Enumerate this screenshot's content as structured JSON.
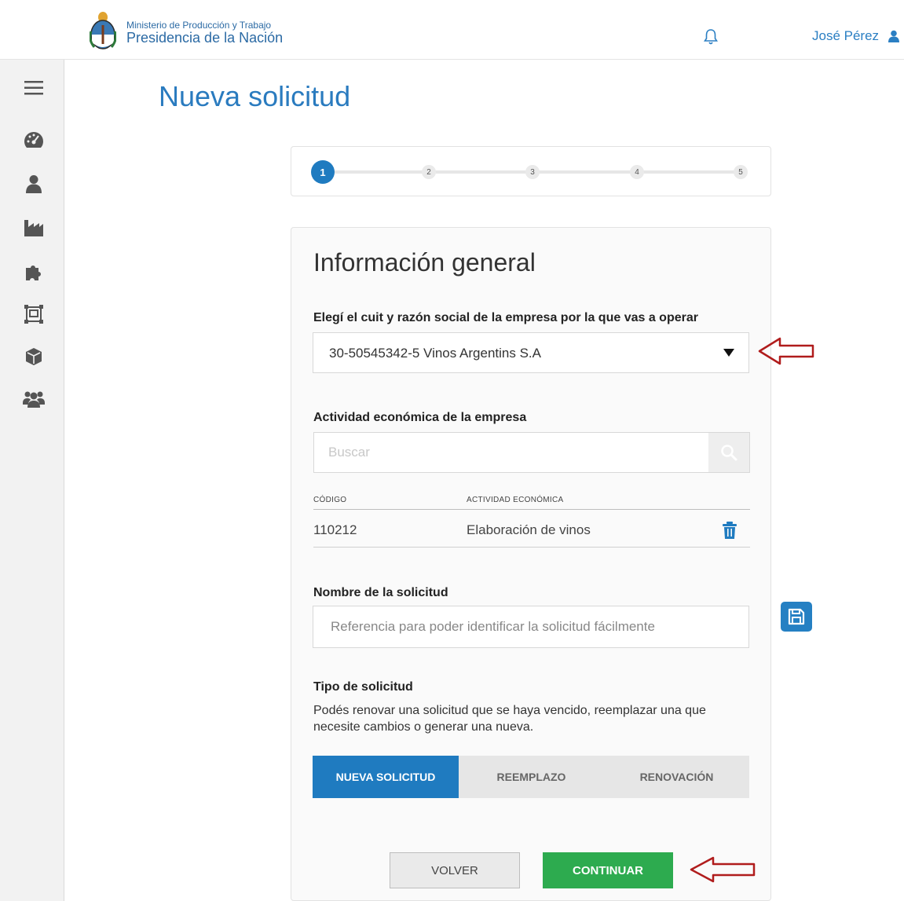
{
  "header": {
    "logo_line1": "Ministerio de Producción y Trabajo",
    "logo_line2": "Presidencia de la Nación",
    "user_name": "José Pérez"
  },
  "sidebar": {
    "icons": [
      "menu-icon",
      "dashboard-icon",
      "user-icon",
      "factory-icon",
      "puzzle-icon",
      "box-frame-icon",
      "cube-icon",
      "users-icon"
    ]
  },
  "page": {
    "title": "Nueva solicitud"
  },
  "stepper": {
    "steps": [
      "1",
      "2",
      "3",
      "4",
      "5"
    ],
    "active_step": 1
  },
  "form": {
    "section_title": "Información general",
    "company_label": "Elegí el cuit y razón social de la empresa por la que vas a operar",
    "company_selected": "30-50545342-5 Vinos Argentins S.A",
    "activity_label": "Actividad económica de la empresa",
    "search_placeholder": "Buscar",
    "table": {
      "headers": [
        "CÓDIGO",
        "ACTIVIDAD ECONÓMICA"
      ],
      "rows": [
        {
          "codigo": "110212",
          "actividad": "Elaboración de vinos"
        }
      ]
    },
    "name_label": "Nombre de la solicitud",
    "name_placeholder": "Referencia para poder identificar la solicitud fácilmente",
    "type_label": "Tipo de solicitud",
    "type_description": "Podés renovar una solicitud que se haya vencido, reemplazar una que necesite cambios o generar una nueva.",
    "type_options": [
      "NUEVA SOLICITUD",
      "REEMPLAZO",
      "RENOVACIÓN"
    ],
    "type_selected": "NUEVA SOLICITUD",
    "back_label": "VOLVER",
    "continue_label": "CONTINUAR"
  },
  "colors": {
    "accent": "#1f7bc0",
    "title": "#2a7bbf",
    "continue": "#2dab4f",
    "annotation_arrow": "#b01c1c"
  }
}
